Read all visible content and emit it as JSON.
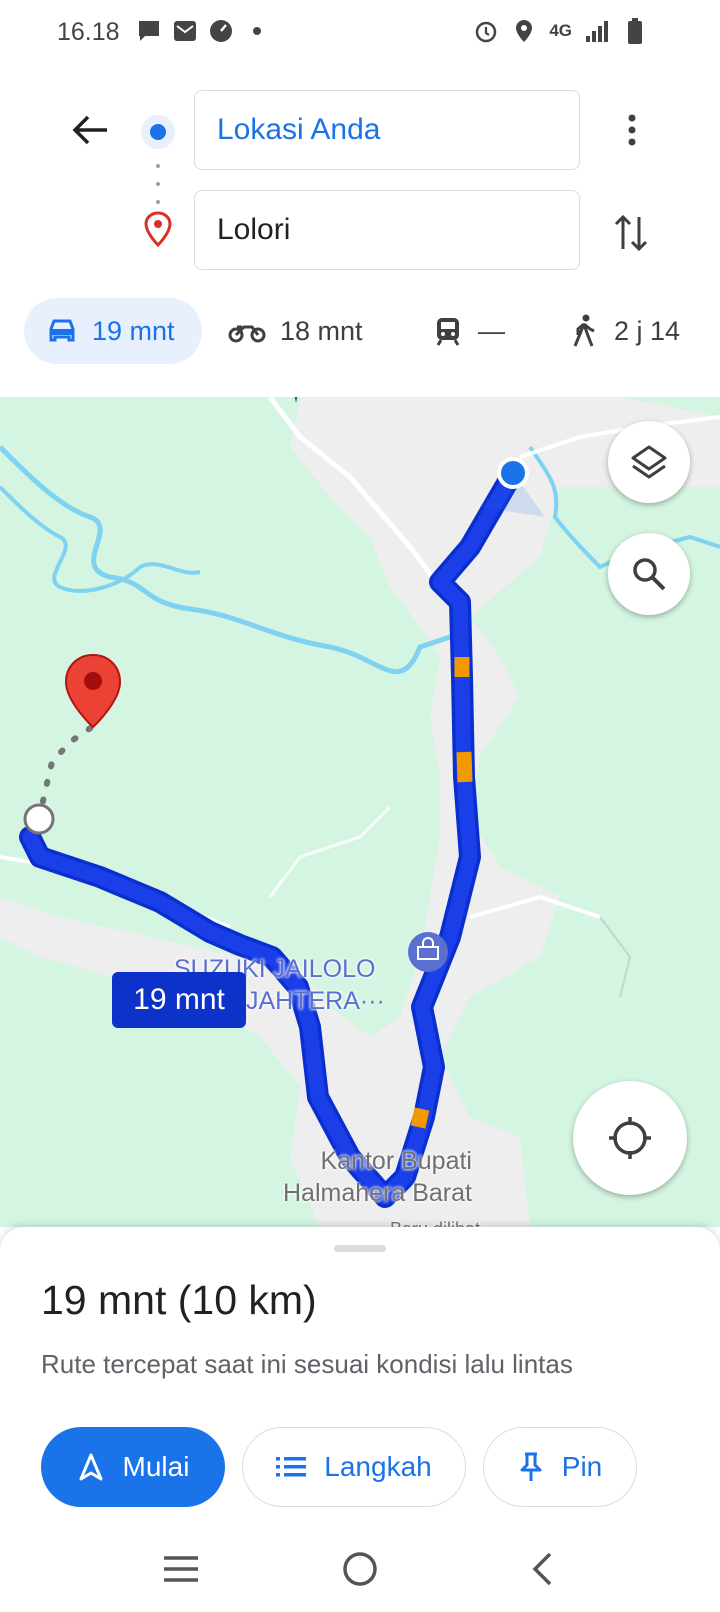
{
  "status_bar": {
    "time": "16.18",
    "network": "4G",
    "icons_left": [
      "chat-icon",
      "mail-icon",
      "gauge-icon",
      "dot-icon"
    ],
    "icons_right": [
      "alarm-icon",
      "location-icon",
      "signal-icon",
      "battery-icon"
    ]
  },
  "search": {
    "origin": "Lokasi Anda",
    "destination": "Lolori"
  },
  "modes": [
    {
      "name": "car",
      "label": "19 mnt",
      "active": true
    },
    {
      "name": "motorcycle",
      "label": "18 mnt",
      "active": false
    },
    {
      "name": "transit",
      "label": "—",
      "active": false
    },
    {
      "name": "walk",
      "label": "2 j 14",
      "active": false
    }
  ],
  "map": {
    "route_time_chip": "19 mnt",
    "poi_suzuki_line1": "SUZUKI JAILOLO",
    "poi_suzuki_line2": "JAHTERA···",
    "poi_kantor_line1": "Kantor Bupati",
    "poi_kantor_line2": "Halmahera Barat",
    "poi_baru": "Baru dilihat",
    "colors": {
      "route": "#1a3ee8",
      "traffic_slow": "#f29900",
      "land": "#d4f5e1",
      "water": "#7fd3f0",
      "road": "#ffffff"
    }
  },
  "sheet": {
    "title": "19 mnt (10 km)",
    "subtitle": "Rute tercepat saat ini sesuai kondisi lalu lintas",
    "start_label": "Mulai",
    "steps_label": "Langkah",
    "pin_label": "Pin"
  }
}
